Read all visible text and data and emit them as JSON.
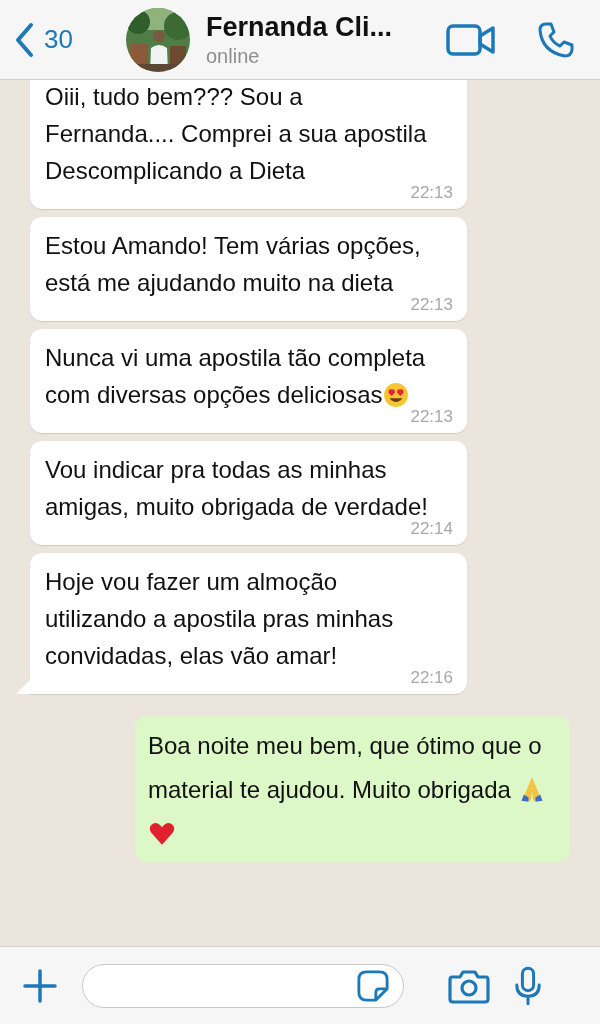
{
  "header": {
    "back_count": "30",
    "contact_name": "Fernanda Cli...",
    "status": "online"
  },
  "messages": [
    {
      "kind": "incoming",
      "text": "Oiii, tudo bem??? Sou a Fernanda.... Comprei a sua apostila Descomplicando a Dieta",
      "time": "22:13",
      "tail": false
    },
    {
      "kind": "incoming",
      "text": "Estou Amando! Tem várias opções, está me ajudando muito na dieta",
      "time": "22:13",
      "tail": false
    },
    {
      "kind": "incoming",
      "text": "Nunca vi uma apostila tão completa com diversas opções deliciosas",
      "time": "22:13",
      "tail": false,
      "emojis": [
        {
          "kind": "heart-eyes"
        }
      ]
    },
    {
      "kind": "incoming",
      "text": "Vou indicar pra todas as minhas amigas, muito obrigada de verdade!",
      "time": "22:14",
      "tail": false
    },
    {
      "kind": "incoming",
      "text": "Hoje vou fazer um almoção utilizando a apostila pras minhas convidadas, elas vão amar!",
      "time": "22:16",
      "tail": true
    },
    {
      "kind": "outgoing",
      "text": "Boa noite meu bem, que ótimo que o material te ajudou. Muito obrigada ",
      "emojis": [
        {
          "kind": "folded-hands"
        },
        {
          "kind": "heart"
        }
      ]
    }
  ]
}
